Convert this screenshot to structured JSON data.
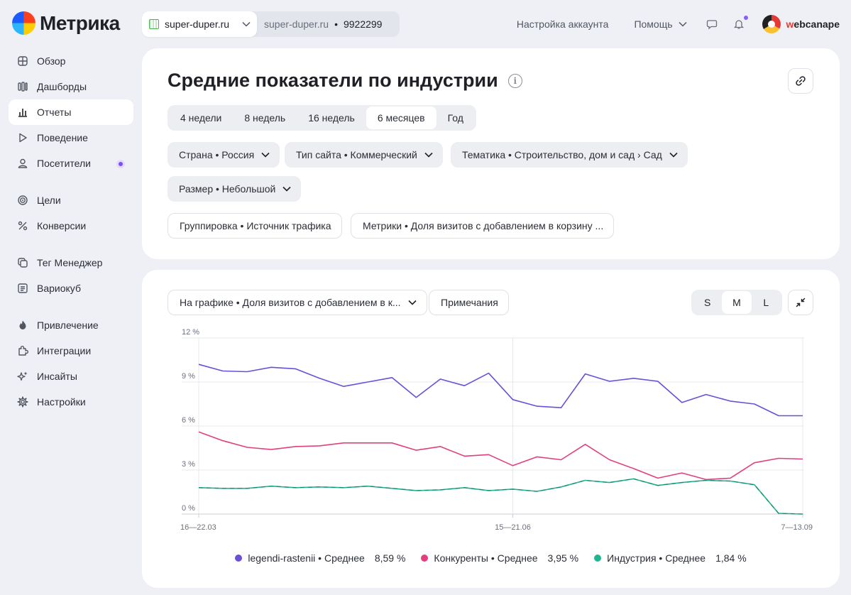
{
  "header": {
    "logo_text": "Метрика",
    "counter_site": "super-duper.ru",
    "counter_site2": "super-duper.ru",
    "counter_dot": "•",
    "counter_id": "9922299",
    "account_settings": "Настройка аккаунта",
    "help": "Помощь",
    "user_w": "w",
    "user_rest": "ebcanape"
  },
  "sidebar": {
    "items": [
      {
        "label": "Обзор",
        "icon": "grid-icon"
      },
      {
        "label": "Дашборды",
        "icon": "dashboards-icon"
      },
      {
        "label": "Отчеты",
        "icon": "reports-icon",
        "active": true
      },
      {
        "label": "Поведение",
        "icon": "play-icon"
      },
      {
        "label": "Посетители",
        "icon": "user-icon"
      },
      {
        "label": "Цели",
        "icon": "target-icon"
      },
      {
        "label": "Конверсии",
        "icon": "percent-icon"
      },
      {
        "label": "Тег Менеджер",
        "icon": "tag-manager-icon"
      },
      {
        "label": "Вариокуб",
        "icon": "variocube-icon"
      },
      {
        "label": "Привлечение",
        "icon": "fire-icon"
      },
      {
        "label": "Интеграции",
        "icon": "puzzle-icon"
      },
      {
        "label": "Инсайты",
        "icon": "sparkle-icon"
      },
      {
        "label": "Настройки",
        "icon": "gear-icon"
      }
    ]
  },
  "report": {
    "title": "Средние показатели по индустрии",
    "info": "i",
    "periods": [
      "4 недели",
      "8 недель",
      "16 недель",
      "6 месяцев",
      "Год"
    ],
    "active_period": "6 месяцев",
    "filters": {
      "country": "Страна • Россия",
      "site_type": "Тип сайта • Коммерческий",
      "topic": "Тематика • Строительство, дом и сад › Сад",
      "size": "Размер • Небольшой"
    },
    "grouping": "Группировка • Источник трафика",
    "metrics": "Метрики • Доля визитов с добавлением в корзину ..."
  },
  "chart_panel": {
    "on_chart": "На графике • Доля визитов с добавлением в к...",
    "notes": "Примечания",
    "sizes": [
      "S",
      "M",
      "L"
    ],
    "active_size": "M"
  },
  "chart_data": {
    "type": "line",
    "ylim": [
      0,
      12
    ],
    "y_ticks": [
      "0 %",
      "3 %",
      "6 %",
      "9 %",
      "12 %"
    ],
    "x_tick_labels": [
      "16—22.03",
      "15—21.06",
      "7—13.09"
    ],
    "x_tick_indices": [
      0,
      13,
      25
    ],
    "series": [
      {
        "name": "legendi-rastenii",
        "suffix": " • Среднее",
        "avg": "8,59 %",
        "color": "#6b4fd8",
        "values": [
          10.2,
          9.75,
          9.7,
          10.0,
          9.9,
          9.25,
          8.7,
          9.0,
          9.3,
          7.95,
          9.2,
          8.75,
          9.6,
          7.8,
          7.35,
          7.25,
          9.55,
          9.05,
          9.25,
          9.05,
          7.6,
          8.15,
          7.7,
          7.5,
          6.7,
          6.7
        ]
      },
      {
        "name": "Конкуренты",
        "suffix": " • Среднее",
        "avg": "3,95 %",
        "color": "#e0407e",
        "values": [
          5.6,
          5.0,
          4.55,
          4.4,
          4.6,
          4.65,
          4.85,
          4.85,
          4.85,
          4.35,
          4.6,
          3.95,
          4.05,
          3.3,
          3.9,
          3.7,
          4.75,
          3.7,
          3.1,
          2.45,
          2.8,
          2.35,
          2.45,
          3.5,
          3.8,
          3.75
        ]
      },
      {
        "name": "Индустрия",
        "suffix": " • Среднее",
        "avg": "1,84 %",
        "color": "#1fb590",
        "values": [
          1.8,
          1.75,
          1.75,
          1.9,
          1.8,
          1.85,
          1.8,
          1.9,
          1.75,
          1.6,
          1.65,
          1.8,
          1.6,
          1.7,
          1.55,
          1.85,
          2.3,
          2.15,
          2.4,
          1.95,
          2.15,
          2.3,
          2.25,
          2.0,
          0.05,
          0.0
        ]
      }
    ]
  }
}
